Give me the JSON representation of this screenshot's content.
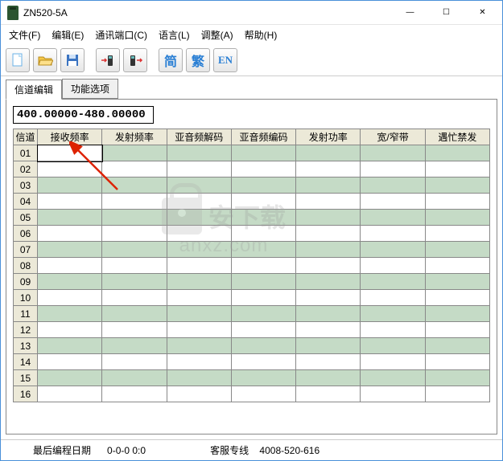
{
  "window": {
    "title": "ZN520-5A"
  },
  "menu": {
    "file": "文件(F)",
    "edit": "编辑(E)",
    "comport": "通讯端口(C)",
    "language": "语言(L)",
    "adjust": "调整(A)",
    "help": "帮助(H)"
  },
  "toolbar": {
    "lang_simp": "简",
    "lang_trad": "繁",
    "lang_en": "EN"
  },
  "tabs": {
    "channel_edit": "信道编辑",
    "func_options": "功能选项"
  },
  "freq_range": "400.00000-480.00000",
  "columns": {
    "ch": "信道",
    "rx": "接收频率",
    "tx": "发射频率",
    "ctcss_dec": "亚音频解码",
    "ctcss_enc": "亚音频编码",
    "power": "发射功率",
    "bw": "宽/窄带",
    "busy": "遇忙禁发"
  },
  "rows": [
    "01",
    "02",
    "03",
    "04",
    "05",
    "06",
    "07",
    "08",
    "09",
    "10",
    "11",
    "12",
    "13",
    "14",
    "15",
    "16"
  ],
  "status": {
    "last_prog_label": "最后编程日期",
    "last_prog_value": "0-0-0   0:0",
    "hotline_label": "客服专线",
    "hotline_value": "4008-520-616"
  },
  "watermark": {
    "cn": "安下载",
    "url": "anxz.com"
  }
}
